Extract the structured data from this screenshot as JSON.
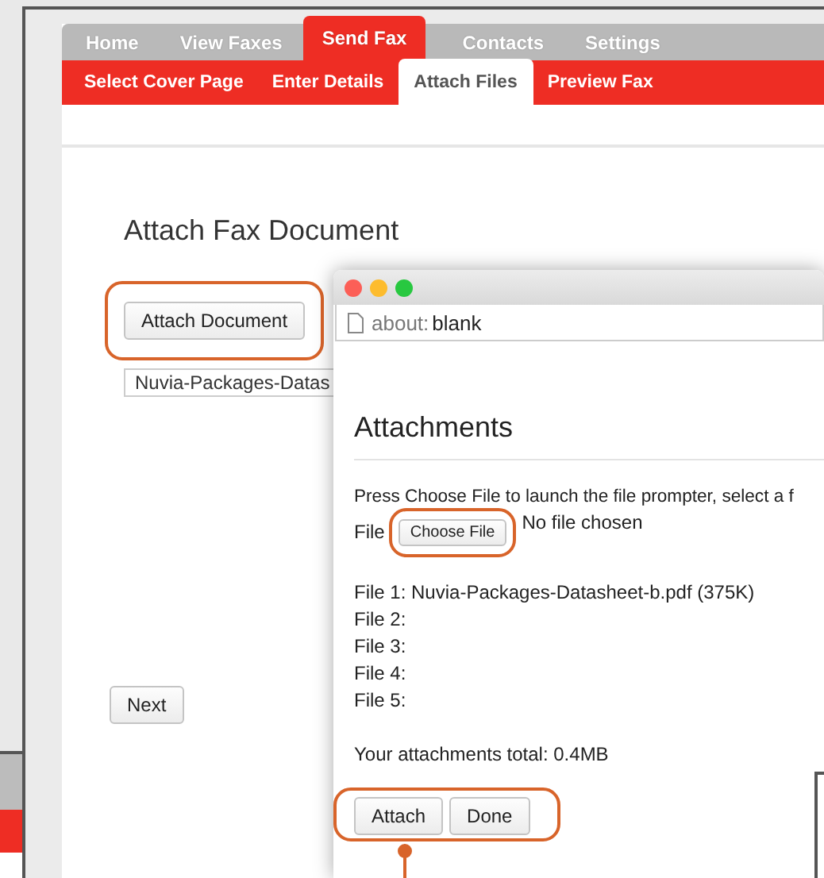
{
  "main_window": {
    "tabs": [
      {
        "label": "Home",
        "selected": false
      },
      {
        "label": "View Faxes",
        "selected": false
      },
      {
        "label": "Send Fax",
        "selected": true
      },
      {
        "label": "Contacts",
        "selected": false
      },
      {
        "label": "Settings",
        "selected": false
      }
    ],
    "steps": [
      {
        "label": "Select Cover Page",
        "selected": false
      },
      {
        "label": "Enter Details",
        "selected": false
      },
      {
        "label": "Attach Files",
        "selected": true
      },
      {
        "label": "Preview Fax",
        "selected": false
      }
    ],
    "heading": "Attach Fax Document",
    "attach_button": {
      "label": "Attach Document",
      "highlighted": true
    },
    "file_field": {
      "value": "Nuvia-Packages-Datas"
    },
    "next_button": {
      "label": "Next"
    }
  },
  "popup": {
    "address": {
      "scheme": "about:",
      "page": "blank"
    },
    "heading": "Attachments",
    "instructions": "Press Choose File to launch the file prompter, select a f",
    "file_label": "File",
    "choose_button": {
      "label": "Choose File",
      "highlighted": true
    },
    "no_file": "No file chosen",
    "files": [
      "File 1: Nuvia-Packages-Datasheet-b.pdf (375K)",
      "File 2:",
      "File 3:",
      "File 4:",
      "File 5:"
    ],
    "total": "Your attachments total: 0.4MB",
    "buttons": [
      {
        "label": "Attach"
      },
      {
        "label": "Done"
      }
    ],
    "buttons_highlighted": true
  }
}
